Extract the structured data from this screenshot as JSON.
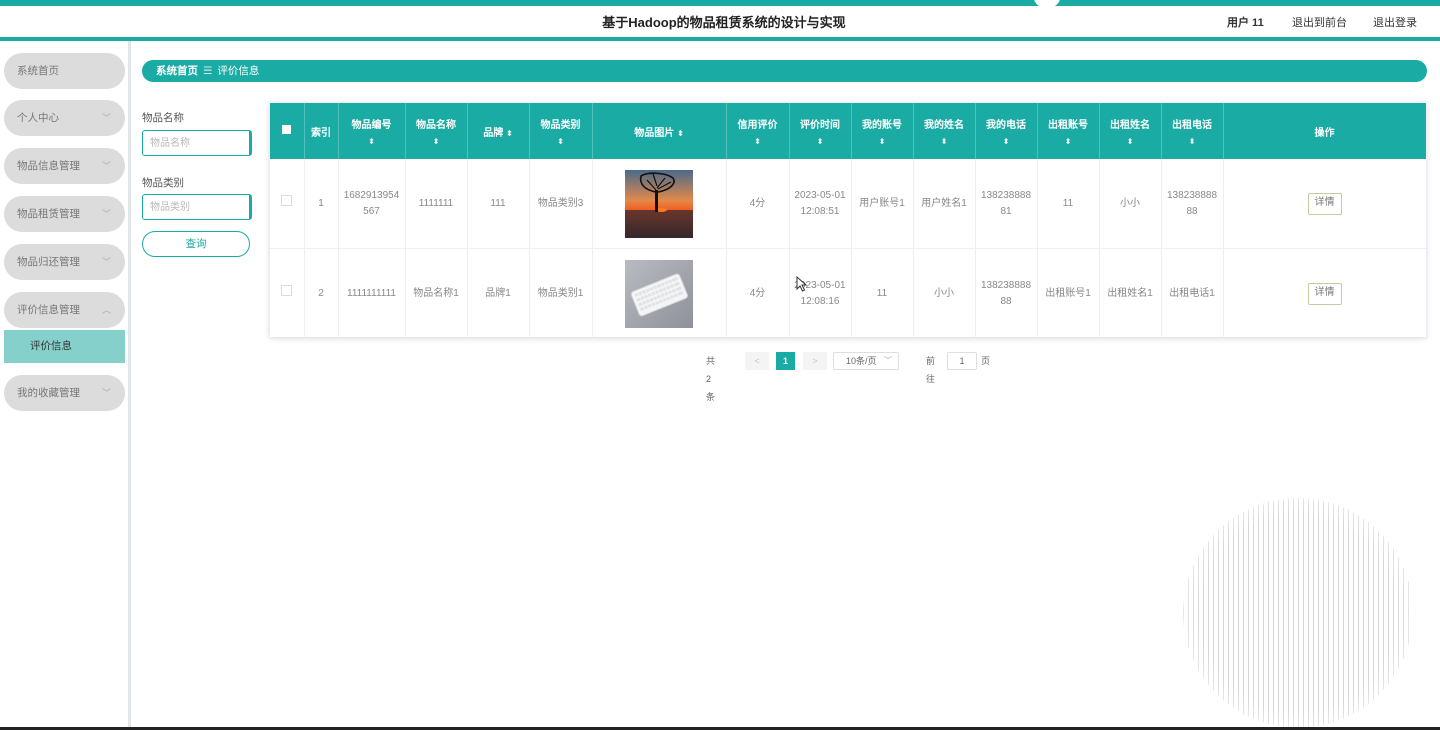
{
  "header": {
    "title": "基于Hadoop的物品租赁系统的设计与实现",
    "user": "用户 11",
    "front_link": "退出到前台",
    "logout_link": "退出登录"
  },
  "sidebar": {
    "items": [
      {
        "label": "系统首页"
      },
      {
        "label": "个人中心"
      },
      {
        "label": "物品信息管理"
      },
      {
        "label": "物品租赁管理"
      },
      {
        "label": "物品归还管理"
      },
      {
        "label": "评价信息管理"
      },
      {
        "label": "我的收藏管理"
      }
    ],
    "sub_item": "评价信息"
  },
  "breadcrumb": {
    "home": "系统首页",
    "separator": "☰",
    "current": "评价信息"
  },
  "filters": {
    "name_label": "物品名称",
    "name_placeholder": "物品名称",
    "category_label": "物品类别",
    "category_placeholder": "物品类别",
    "search_button": "查询"
  },
  "table": {
    "columns": [
      "索引",
      "物品编号",
      "物品名称",
      "品牌",
      "物品类别",
      "物品图片",
      "信用评价",
      "评价时间",
      "我的账号",
      "我的姓名",
      "我的电话",
      "出租账号",
      "出租姓名",
      "出租电话",
      "操作"
    ],
    "sort_icon": "⬍",
    "detail_label": "详情",
    "rows": [
      {
        "index": "1",
        "item_no": "1682913954567",
        "item_name": "1111111",
        "brand": "111",
        "category": "物品类别3",
        "image": "sunset-tree",
        "rating": "4分",
        "time": "2023-05-01 12:08:51",
        "my_account": "用户账号1",
        "my_name": "用户姓名1",
        "my_phone": "13823888881",
        "rent_account": "11",
        "rent_name": "小小",
        "rent_phone": "13823888888"
      },
      {
        "index": "2",
        "item_no": "1111111111",
        "item_name": "物品名称1",
        "brand": "品牌1",
        "category": "物品类别1",
        "image": "keyboard",
        "rating": "4分",
        "time": "2023-05-01 12:08:16",
        "my_account": "11",
        "my_name": "小小",
        "my_phone": "13823888888",
        "rent_account": "出租账号1",
        "rent_name": "出租姓名1",
        "rent_phone": "出租电话1"
      }
    ]
  },
  "pagination": {
    "total": "共 2 条",
    "prev": "<",
    "page": "1",
    "next": ">",
    "page_size": "10条/页",
    "goto": "前往",
    "goto_value": "1",
    "goto_unit": "页"
  },
  "colors": {
    "accent": "#1aaba4",
    "sidebar_pill": "#dcdcdc",
    "active_sub": "#86d0cc"
  }
}
